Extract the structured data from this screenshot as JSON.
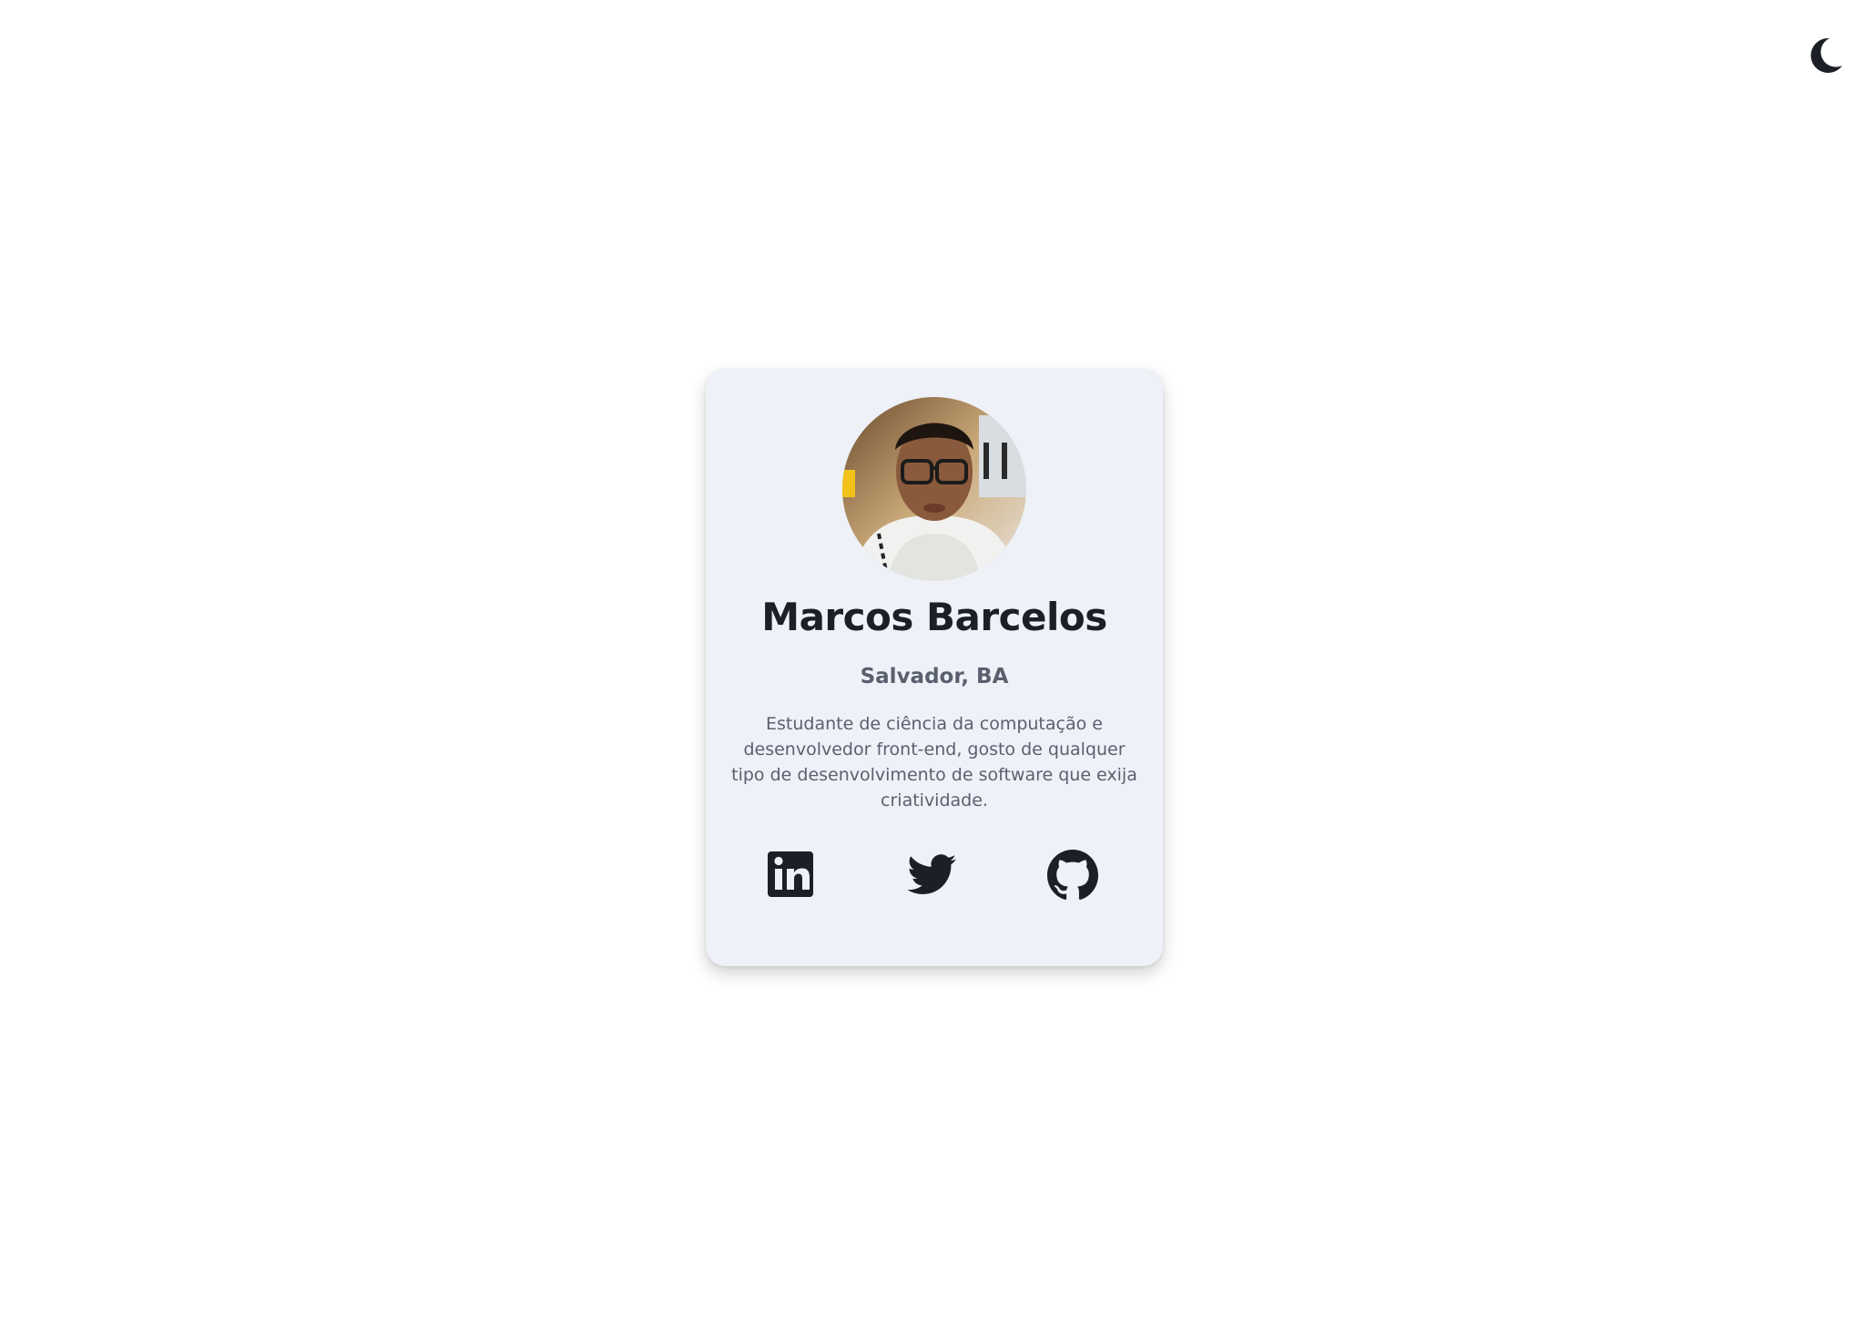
{
  "theme_toggle": {
    "icon": "moon-icon"
  },
  "profile": {
    "name": "Marcos Barcelos",
    "location": "Salvador, BA",
    "bio": "Estudante de ciência da computação e desenvolvedor front-end, gosto de qualquer tipo de desenvolvimento de software que exija criatividade.",
    "avatar_icon": "profile-photo"
  },
  "social_links": [
    {
      "icon": "linkedin-icon"
    },
    {
      "icon": "twitter-icon"
    },
    {
      "icon": "github-icon"
    }
  ],
  "colors": {
    "background": "#ffffff",
    "card": "#eef1f8",
    "text_dark": "#1d1f26",
    "text_muted": "#5a5f6e"
  }
}
